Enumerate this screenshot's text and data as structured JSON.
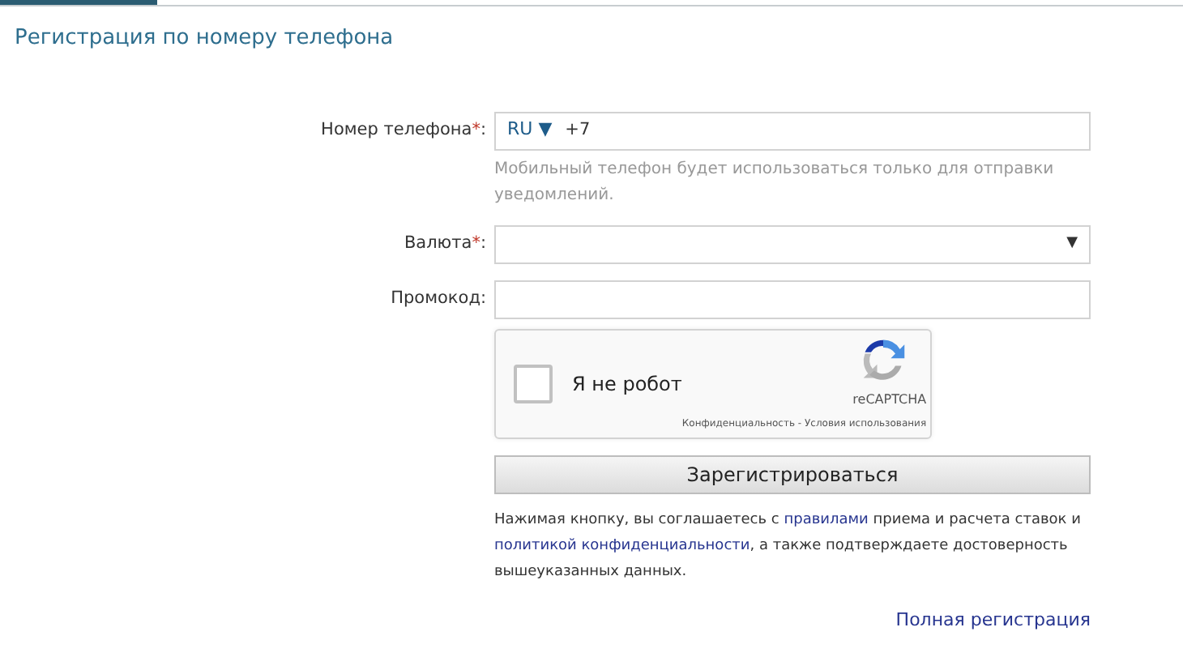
{
  "title": "Регистрация по номеру телефона",
  "fields": [
    {
      "kind": "phone",
      "label": "Номер телефона",
      "required_mark": "*",
      "suffix": ":",
      "country": "RU",
      "caret": "▼",
      "value": "+7",
      "hint": "Мобильный телефон будет использоваться только для отправки уведомлений."
    },
    {
      "kind": "select",
      "label": "Валюта",
      "required_mark": "*",
      "suffix": ":",
      "caret": "▼"
    },
    {
      "kind": "text",
      "label": "Промокод",
      "suffix": ":"
    }
  ],
  "captcha": {
    "checked": false,
    "label": "Я не робот",
    "brand": "reCAPTCHA",
    "privacy": "Конфиденциальность",
    "separator": " - ",
    "terms": "Условия использования"
  },
  "submit": "Зарегистрироваться",
  "terms": [
    {
      "kind": "text",
      "text": "Нажимая кнопку, вы соглашаетесь с "
    },
    {
      "kind": "link",
      "text": "правилами"
    },
    {
      "kind": "text",
      "text": " приема и расчета ставок и "
    },
    {
      "kind": "link",
      "text": "политикой конфиденциальности"
    },
    {
      "kind": "text",
      "text": ", а также подтверждаете достоверность вышеуказанных данных."
    }
  ],
  "full_registration": "Полная регистрация"
}
